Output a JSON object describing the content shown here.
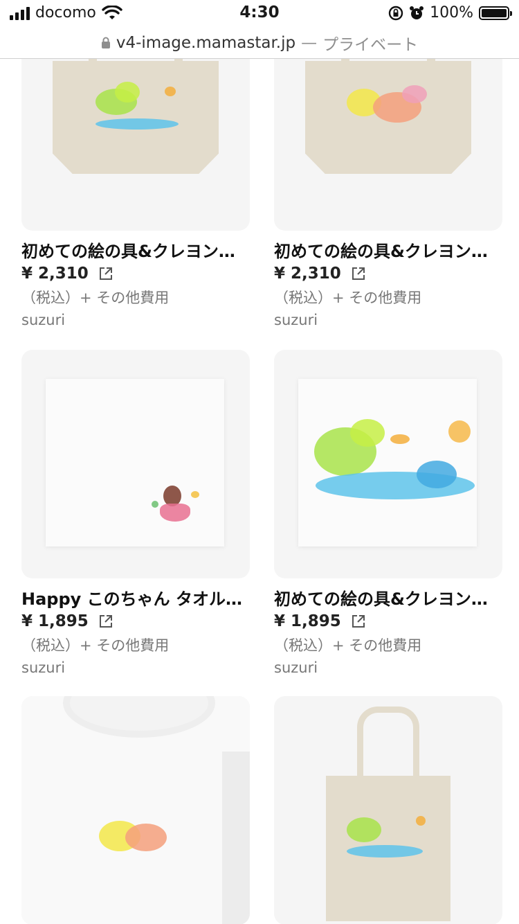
{
  "status_bar": {
    "carrier": "docomo",
    "time": "4:30",
    "battery": "100%"
  },
  "url_bar": {
    "domain": "v4-image.mamastar.jp",
    "separator": "—",
    "mode": "プライベート"
  },
  "products": [
    {
      "title": "初めての絵の具&クレヨン…",
      "price": "¥ 2,310",
      "tax": "（税込）+ その他費用",
      "seller": "suzuri",
      "image": "tote-bag-green-blue-art"
    },
    {
      "title": "初めての絵の具&クレヨン…",
      "price": "¥ 2,310",
      "tax": "（税込）+ その他費用",
      "seller": "suzuri",
      "image": "tote-bag-yellow-pink-art"
    },
    {
      "title": "Happy このちゃん タオル…",
      "price": "¥ 1,895",
      "tax": "（税込）+ その他費用",
      "seller": "suzuri",
      "image": "towel-character"
    },
    {
      "title": "初めての絵の具&クレヨン…",
      "price": "¥ 1,895",
      "tax": "（税込）+ その他費用",
      "seller": "suzuri",
      "image": "towel-green-blue-art"
    },
    {
      "image": "tshirt-yellow-art"
    },
    {
      "image": "tote-bag-tall-green-blue-art"
    }
  ]
}
